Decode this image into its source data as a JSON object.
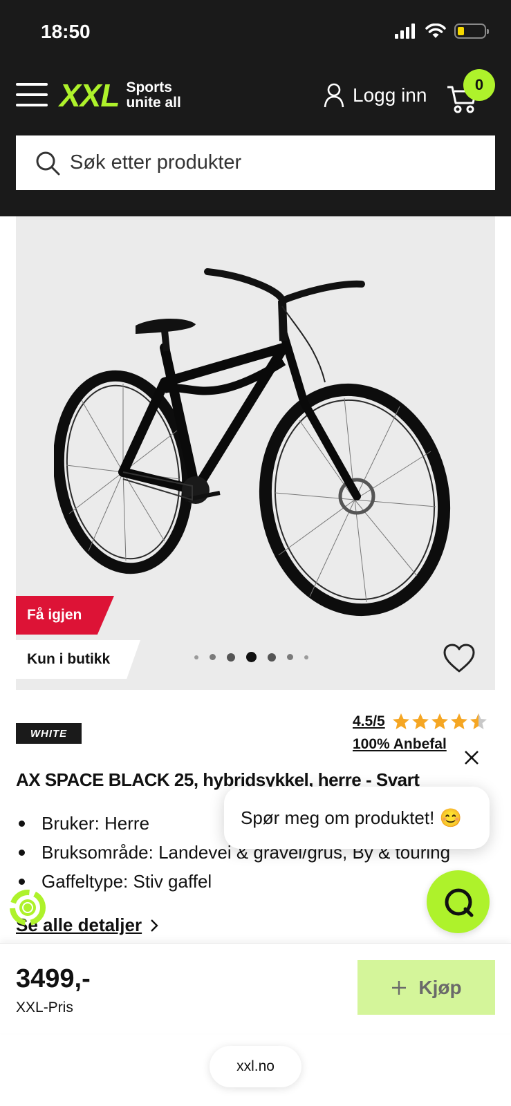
{
  "status_bar": {
    "time": "18:50"
  },
  "header": {
    "logo_text": "XXL",
    "logo_tagline_1": "Sports",
    "logo_tagline_2": "unite all",
    "login_label": "Logg inn",
    "cart_count": "0",
    "icons": [
      "menu-icon",
      "user-icon",
      "cart-icon",
      "search-icon"
    ]
  },
  "search": {
    "placeholder": "Søk etter produkter"
  },
  "gallery": {
    "tags": {
      "back_in_stock": "Få igjen",
      "store_only": "Kun i butikk"
    },
    "image_count": 7,
    "active_index": 3
  },
  "product": {
    "brand": "WHITE",
    "rating": "4.5/5",
    "rating_value": 4.5,
    "recommend": "100% Anbefal",
    "title": "AX SPACE BLACK 25, hybridsykkel, herre - Svart",
    "features": [
      "Bruker: Herre",
      "Bruksområde: Landevei & gravel/grus, By & touring",
      "Gaffeltype: Stiv gaffel"
    ],
    "details_link": "Se alle detaljer"
  },
  "chat": {
    "prompt": "Spør meg om produktet! 😊"
  },
  "purchase": {
    "price": "3499,-",
    "price_label": "XXL-Pris",
    "buy_label": "Kjøp"
  },
  "browser": {
    "url": "xxl.no"
  },
  "colors": {
    "brand_green": "#aef22b",
    "header_bg": "#1a1a1a",
    "tag_red": "#dd1336",
    "buy_bg": "#d4f59a",
    "star": "#f5a623"
  }
}
